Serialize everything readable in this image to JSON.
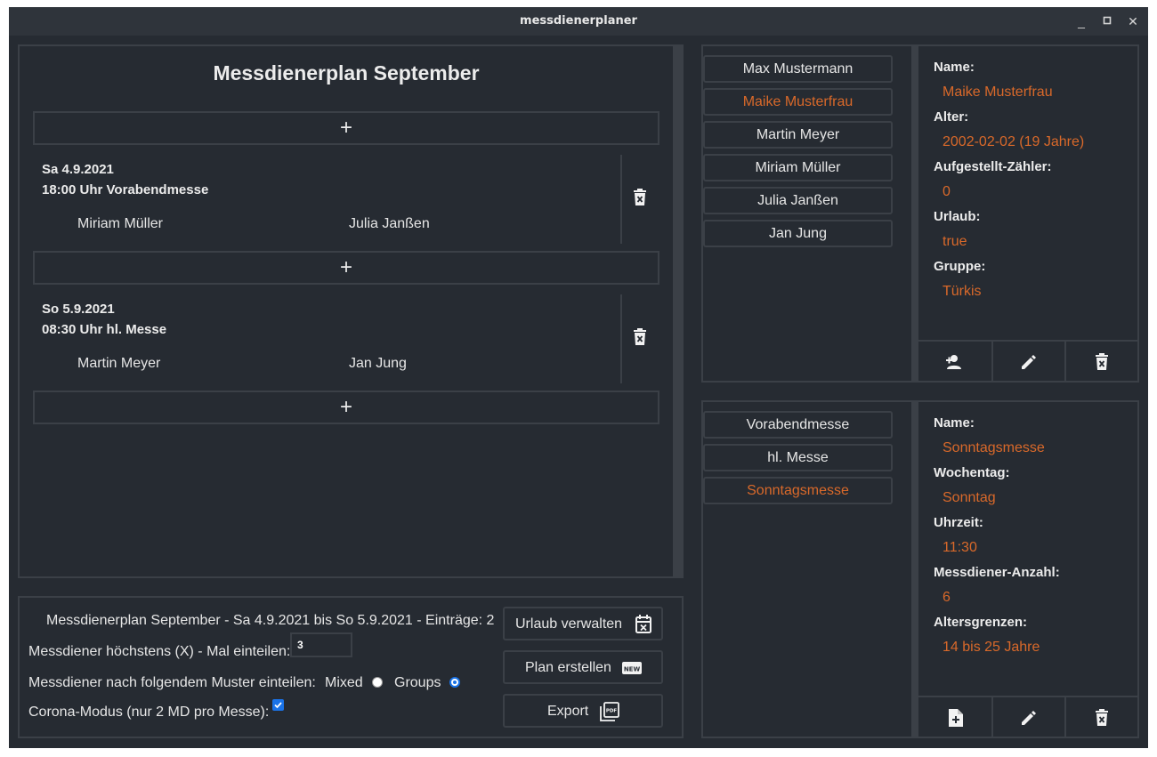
{
  "window": {
    "title": "messdienerplaner",
    "minimize": "_",
    "maximize": "▫",
    "close": "✕"
  },
  "plan": {
    "title": "Messdienerplan September",
    "add_symbol": "+",
    "entries": [
      {
        "date": "Sa 4.9.2021",
        "mass": "18:00 Uhr Vorabendmesse",
        "servers": [
          "Miriam Müller",
          "Julia Janßen"
        ]
      },
      {
        "date": "So 5.9.2021",
        "mass": "08:30 Uhr hl. Messe",
        "servers": [
          "Martin Meyer",
          "Jan Jung"
        ]
      }
    ]
  },
  "footer": {
    "summary": "Messdienerplan September - Sa 4.9.2021 bis So 5.9.2021 - Einträge: 2",
    "max_label": "Messdiener höchstens (X) - Mal einteilen:",
    "max_value": "3",
    "pattern_label": "Messdiener nach folgendem Muster einteilen:",
    "mixed_label": "Mixed",
    "groups_label": "Groups",
    "selected_pattern": "Groups",
    "corona_label": "Corona-Modus (nur 2 MD pro Messe):",
    "corona_checked": true,
    "buttons": {
      "vacation": "Urlaub verwalten",
      "create": "Plan erstellen",
      "export": "Export"
    },
    "new_badge": "NEW",
    "pdf_badge": "PDF"
  },
  "servers": {
    "list": [
      "Max Mustermann",
      "Maike Musterfrau",
      "Martin Meyer",
      "Miriam Müller",
      "Julia Janßen",
      "Jan Jung"
    ],
    "selected": "Maike Musterfrau",
    "details": [
      {
        "label": "Name:",
        "value": "Maike Musterfrau"
      },
      {
        "label": "Alter:",
        "value": "2002-02-02 (19 Jahre)"
      },
      {
        "label": "Aufgestellt-Zähler:",
        "value": "0"
      },
      {
        "label": "Urlaub:",
        "value": "true"
      },
      {
        "label": "Gruppe:",
        "value": "Türkis"
      }
    ]
  },
  "masses": {
    "list": [
      "Vorabendmesse",
      "hl. Messe",
      "Sonntagsmesse"
    ],
    "selected": "Sonntagsmesse",
    "details": [
      {
        "label": "Name:",
        "value": "Sonntagsmesse"
      },
      {
        "label": "Wochentag:",
        "value": "Sonntag"
      },
      {
        "label": "Uhrzeit:",
        "value": "11:30"
      },
      {
        "label": "Messdiener-Anzahl:",
        "value": "6"
      },
      {
        "label": "Altersgrenzen:",
        "value": "14 bis 25 Jahre"
      }
    ]
  },
  "colors": {
    "background": "#262b32",
    "border": "#3b4047",
    "accent": "#d9692a",
    "text": "#e6e6e6",
    "checkbox": "#1a73e8"
  },
  "icons": {
    "add_user": "add-user-icon",
    "add_file": "add-file-icon",
    "edit": "pencil-icon",
    "delete": "trash-icon",
    "calendar": "calendar-x-icon",
    "pdf": "pdf-icon",
    "new": "new-badge-icon"
  }
}
